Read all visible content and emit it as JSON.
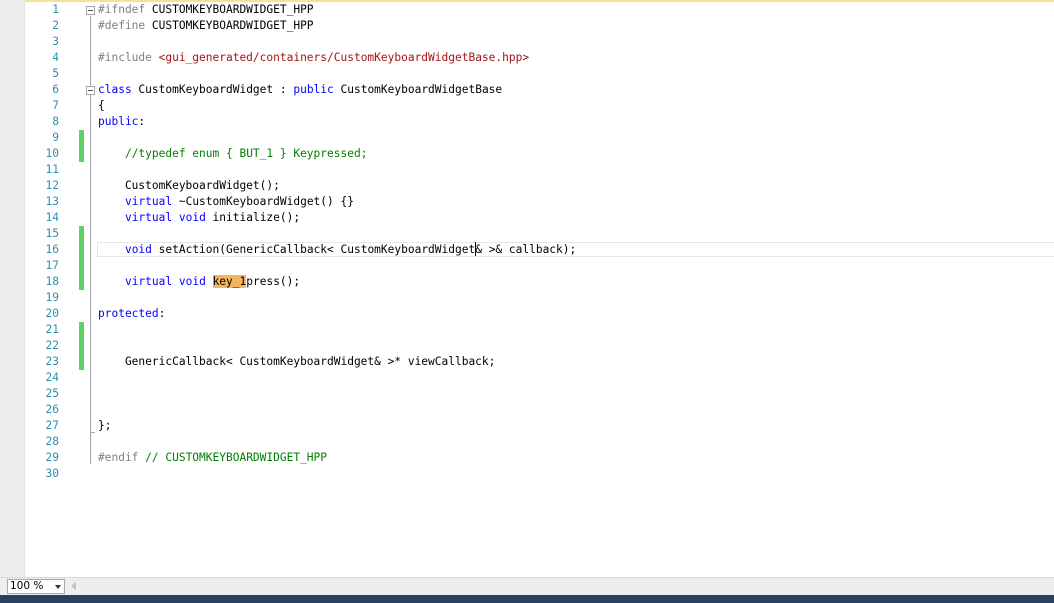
{
  "editor": {
    "lines": [
      {
        "n": "1",
        "changed": false,
        "tokens": [
          {
            "t": "#ifndef ",
            "c": "pp"
          },
          {
            "t": "CUSTOMKEYBOARDWIDGET_HPP",
            "c": ""
          }
        ]
      },
      {
        "n": "2",
        "changed": false,
        "tokens": [
          {
            "t": "#define ",
            "c": "pp"
          },
          {
            "t": "CUSTOMKEYBOARDWIDGET_HPP",
            "c": ""
          }
        ]
      },
      {
        "n": "3",
        "changed": false,
        "tokens": []
      },
      {
        "n": "4",
        "changed": false,
        "tokens": [
          {
            "t": "#include ",
            "c": "pp"
          },
          {
            "t": "<gui_generated/containers/CustomKeyboardWidgetBase.hpp>",
            "c": "str"
          }
        ]
      },
      {
        "n": "5",
        "changed": false,
        "tokens": []
      },
      {
        "n": "6",
        "changed": false,
        "tokens": [
          {
            "t": "class",
            "c": "kw"
          },
          {
            "t": " CustomKeyboardWidget : ",
            "c": ""
          },
          {
            "t": "public",
            "c": "kw"
          },
          {
            "t": " CustomKeyboardWidgetBase",
            "c": ""
          }
        ]
      },
      {
        "n": "7",
        "changed": false,
        "tokens": [
          {
            "t": "{",
            "c": ""
          }
        ]
      },
      {
        "n": "8",
        "changed": false,
        "tokens": [
          {
            "t": "public",
            "c": "kw"
          },
          {
            "t": ":",
            "c": ""
          }
        ]
      },
      {
        "n": "9",
        "changed": true,
        "tokens": []
      },
      {
        "n": "10",
        "changed": true,
        "tokens": [
          {
            "t": "    ",
            "c": ""
          },
          {
            "t": "//typedef enum { BUT_1 } Keypressed;",
            "c": "cm"
          }
        ]
      },
      {
        "n": "11",
        "changed": false,
        "tokens": []
      },
      {
        "n": "12",
        "changed": false,
        "tokens": [
          {
            "t": "    CustomKeyboardWidget();",
            "c": ""
          }
        ]
      },
      {
        "n": "13",
        "changed": false,
        "tokens": [
          {
            "t": "    ",
            "c": ""
          },
          {
            "t": "virtual",
            "c": "kw"
          },
          {
            "t": " ~CustomKeyboardWidget() {}",
            "c": ""
          }
        ]
      },
      {
        "n": "14",
        "changed": false,
        "tokens": [
          {
            "t": "    ",
            "c": ""
          },
          {
            "t": "virtual",
            "c": "kw"
          },
          {
            "t": " ",
            "c": ""
          },
          {
            "t": "void",
            "c": "kw"
          },
          {
            "t": " initialize();",
            "c": ""
          }
        ]
      },
      {
        "n": "15",
        "changed": true,
        "tokens": []
      },
      {
        "n": "16",
        "changed": true,
        "tokens": [
          {
            "t": "    ",
            "c": ""
          },
          {
            "t": "void",
            "c": "kw"
          },
          {
            "t": " setAction(GenericCallback< CustomKeyboardWidget",
            "c": ""
          },
          {
            "t": "",
            "c": "caret"
          },
          {
            "t": "& >& callback);",
            "c": ""
          }
        ]
      },
      {
        "n": "17",
        "changed": true,
        "tokens": []
      },
      {
        "n": "18",
        "changed": true,
        "tokens": [
          {
            "t": "    ",
            "c": ""
          },
          {
            "t": "virtual",
            "c": "kw"
          },
          {
            "t": " ",
            "c": ""
          },
          {
            "t": "void",
            "c": "kw"
          },
          {
            "t": " ",
            "c": ""
          },
          {
            "t": "key_1",
            "c": "hl"
          },
          {
            "t": "press();",
            "c": ""
          }
        ]
      },
      {
        "n": "19",
        "changed": false,
        "tokens": []
      },
      {
        "n": "20",
        "changed": false,
        "tokens": [
          {
            "t": "protected",
            "c": "kw"
          },
          {
            "t": ":",
            "c": ""
          }
        ]
      },
      {
        "n": "21",
        "changed": true,
        "tokens": []
      },
      {
        "n": "22",
        "changed": true,
        "tokens": []
      },
      {
        "n": "23",
        "changed": true,
        "tokens": [
          {
            "t": "    GenericCallback< CustomKeyboardWidget& >* viewCallback;",
            "c": ""
          }
        ]
      },
      {
        "n": "24",
        "changed": false,
        "tokens": []
      },
      {
        "n": "25",
        "changed": false,
        "tokens": []
      },
      {
        "n": "26",
        "changed": false,
        "tokens": []
      },
      {
        "n": "27",
        "changed": false,
        "tokens": [
          {
            "t": "};",
            "c": ""
          }
        ]
      },
      {
        "n": "28",
        "changed": false,
        "tokens": []
      },
      {
        "n": "29",
        "changed": false,
        "tokens": [
          {
            "t": "#endif ",
            "c": "pp"
          },
          {
            "t": "// CUSTOMKEYBOARDWIDGET_HPP",
            "c": "cm"
          }
        ]
      },
      {
        "n": "30",
        "changed": false,
        "tokens": []
      }
    ]
  },
  "statusbar": {
    "zoom": "100 %"
  },
  "colors": {
    "keyword": "#0000ff",
    "preprocessor": "#808080",
    "string": "#a31515",
    "comment": "#008000",
    "line_number": "#2b91af",
    "changed_marker": "#5fd068",
    "highlight": "#f5b55b"
  }
}
